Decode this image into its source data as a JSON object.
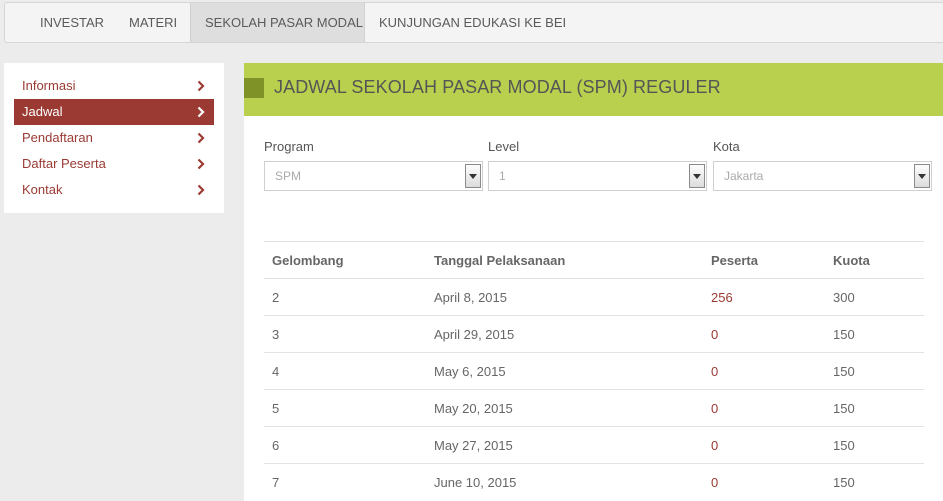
{
  "topnav": {
    "tabs": [
      {
        "label": "INVESTAR"
      },
      {
        "label": "MATERI"
      },
      {
        "label": "SEKOLAH PASAR MODAL"
      },
      {
        "label": "KUNJUNGAN EDUKASI KE BEI"
      }
    ],
    "active_tab": "SEKOLAH PASAR MODAL"
  },
  "sidebar": {
    "items": [
      {
        "label": "Informasi",
        "icon": "chevron-right-icon"
      },
      {
        "label": "Jadwal",
        "icon": "chevron-right-icon"
      },
      {
        "label": "Pendaftaran",
        "icon": "chevron-right-icon"
      },
      {
        "label": "Daftar Peserta",
        "icon": "chevron-right-icon"
      },
      {
        "label": "Kontak",
        "icon": "chevron-right-icon"
      }
    ],
    "active_item": "Jadwal"
  },
  "main": {
    "title": "JADWAL SEKOLAH PASAR MODAL (SPM) REGULER",
    "filters": {
      "program": {
        "label": "Program",
        "value": "SPM"
      },
      "level": {
        "label": "Level",
        "value": "1"
      },
      "kota": {
        "label": "Kota",
        "value": "Jakarta"
      }
    },
    "table": {
      "headers": [
        "Gelombang",
        "Tanggal Pelaksanaan",
        "Peserta",
        "Kuota"
      ],
      "rows": [
        [
          "2",
          "April 8, 2015",
          "256",
          "300"
        ],
        [
          "3",
          "April 29, 2015",
          "0",
          "150"
        ],
        [
          "4",
          "May 6, 2015",
          "0",
          "150"
        ],
        [
          "5",
          "May 20, 2015",
          "0",
          "150"
        ],
        [
          "6",
          "May 27, 2015",
          "0",
          "150"
        ],
        [
          "7",
          "June 10, 2015",
          "0",
          "150"
        ]
      ]
    }
  },
  "colors": {
    "accent_red": "#9a3a33",
    "banner_green": "#b9d04e",
    "banner_square": "#7f9228"
  }
}
